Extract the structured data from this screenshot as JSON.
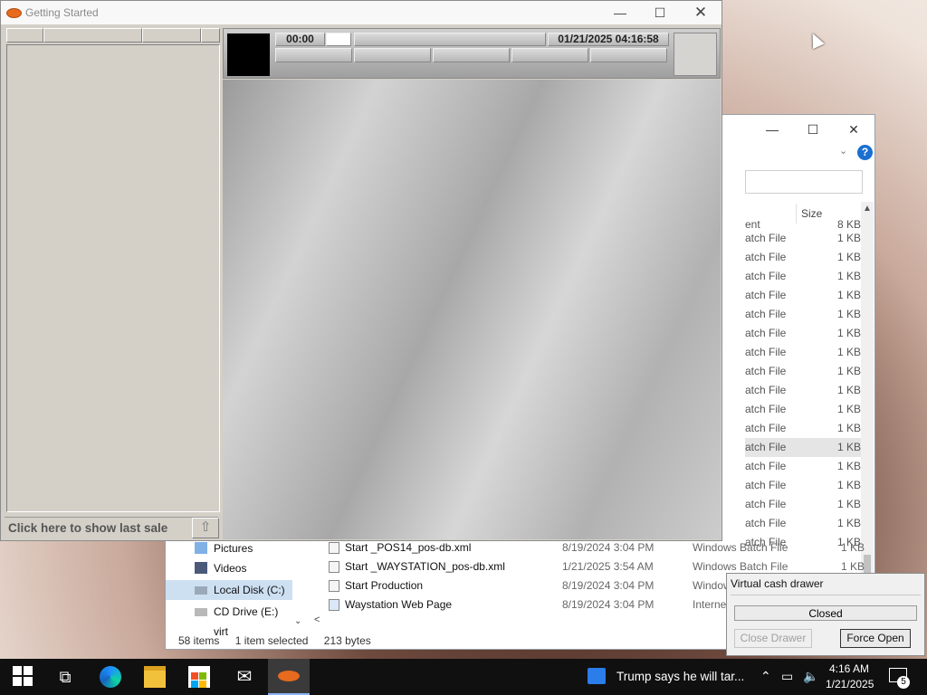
{
  "getting_started": {
    "title": "Getting Started",
    "minimize": "—",
    "maximize": "☐",
    "close": "✕",
    "timer": "00:00",
    "datetime": "01/21/2025 04:16:58",
    "last_sale_label": "Click here to show last sale",
    "last_sale_icon": "⇧"
  },
  "explorer": {
    "minimize": "—",
    "maximize": "☐",
    "close": "✕",
    "help": "?",
    "column_size": "Size",
    "partial_type_header": "ent",
    "partial_size_header": "8 KB",
    "partial_rows": [
      {
        "type": "atch File",
        "size": "1 KB"
      },
      {
        "type": "atch File",
        "size": "1 KB"
      },
      {
        "type": "atch File",
        "size": "1 KB"
      },
      {
        "type": "atch File",
        "size": "1 KB"
      },
      {
        "type": "atch File",
        "size": "1 KB"
      },
      {
        "type": "atch File",
        "size": "1 KB"
      },
      {
        "type": "atch File",
        "size": "1 KB"
      },
      {
        "type": "atch File",
        "size": "1 KB"
      },
      {
        "type": "atch File",
        "size": "1 KB"
      },
      {
        "type": "atch File",
        "size": "1 KB"
      },
      {
        "type": "atch File",
        "size": "1 KB"
      },
      {
        "type": "atch File",
        "size": "1 KB"
      },
      {
        "type": "atch File",
        "size": "1 KB"
      },
      {
        "type": "atch File",
        "size": "1 KB"
      },
      {
        "type": "atch File",
        "size": "1 KB"
      },
      {
        "type": "atch File",
        "size": "1 KB"
      },
      {
        "type": "atch File",
        "size": "1 KB"
      }
    ],
    "nav_items": [
      {
        "label": "Pictures"
      },
      {
        "label": "Videos"
      },
      {
        "label": "Local Disk (C:)"
      },
      {
        "label": "CD Drive (E:) virt"
      }
    ],
    "files": [
      {
        "name": "Start _POS14_pos-db.xml",
        "date": "8/19/2024 3:04 PM",
        "type": "Windows Batch File",
        "size": "1 KB"
      },
      {
        "name": "Start _WAYSTATION_pos-db.xml",
        "date": "1/21/2025 3:54 AM",
        "type": "Windows Batch File",
        "size": "1 KB"
      },
      {
        "name": "Start Production",
        "date": "8/19/2024 3:04 PM",
        "type": "Window",
        "size": ""
      },
      {
        "name": "Waystation Web Page",
        "date": "8/19/2024 3:04 PM",
        "type": "Interne",
        "size": ""
      }
    ],
    "status": {
      "items": "58 items",
      "selected": "1 item selected",
      "bytes": "213 bytes"
    }
  },
  "cash_drawer": {
    "title": "Virtual cash drawer",
    "status": "Closed",
    "close_button": "Close Drawer",
    "force_open_button": "Force Open"
  },
  "taskbar": {
    "news": "Trump says he will tar...",
    "time": "4:16 AM",
    "date": "1/21/2025",
    "notification_count": "5"
  }
}
